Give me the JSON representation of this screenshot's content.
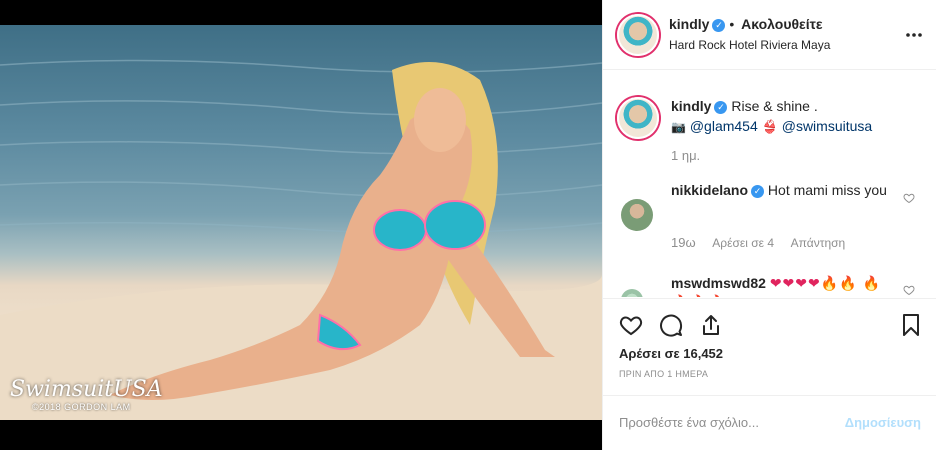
{
  "header": {
    "username": "kindly",
    "verified_glyph": "✓",
    "separator": "•",
    "follow_label": "Ακολουθείτε",
    "location": "Hard Rock Hotel Riviera Maya"
  },
  "post": {
    "watermark_brand": "SwimsuitUSA",
    "watermark_credit": "©2018 GORDON LAM",
    "caption_username": "kindly",
    "caption_text": "Rise & shine .",
    "caption_mention_1": "@glam454",
    "caption_mention_2": "@swimsuitusa",
    "caption_time": "1 ημ."
  },
  "comments": [
    {
      "username": "nikkidelano",
      "text": "Hot mami miss you",
      "time": "19ω",
      "likes_label": "Αρέσει σε 4",
      "reply_label": "Απάντηση"
    },
    {
      "username": "mswdmswd82",
      "text": "❤❤❤❤🔥🔥 🔥🔥🔥🔥"
    }
  ],
  "actions": {
    "like_count_label": "Αρέσει σε 16,452",
    "date_label": "ΠΡΙΝ ΑΠΟ 1 ΗΜΕΡΑ"
  },
  "composer": {
    "placeholder": "Προσθέστε ένα σχόλιο...",
    "publish_label": "Δημοσίευση"
  },
  "icons": [
    "more-icon",
    "heart-icon",
    "comment-icon",
    "share-icon",
    "bookmark-icon",
    "verified-icon"
  ],
  "colors": {
    "link": "#003569",
    "verified": "#3897f0",
    "muted": "#8e8e8e",
    "publish_disabled": "#b2dffc"
  }
}
